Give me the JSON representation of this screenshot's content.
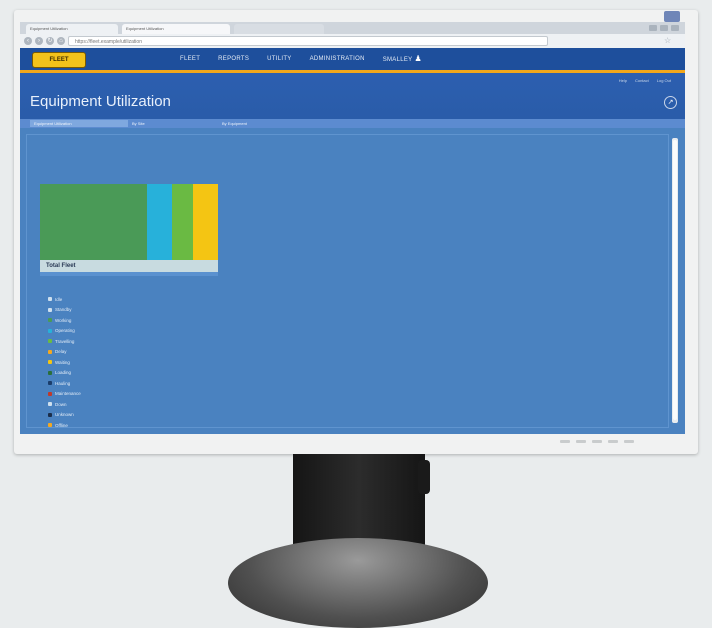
{
  "browser": {
    "tabs": [
      {
        "label": "Equipment Utilization"
      },
      {
        "label": "Equipment Utilization"
      },
      {
        "label": ""
      }
    ],
    "url": "https://fleet.example/utilization"
  },
  "app": {
    "logo_text": "FLEET",
    "menu": [
      "FLEET",
      "REPORTS",
      "UTILITY",
      "ADMINISTRATION",
      "SMALLEY"
    ],
    "utility_links": [
      "Help",
      "Contact",
      "Log Out"
    ],
    "page_title": "Equipment Utilization",
    "subtabs": [
      "Equipment Utilization",
      "By Site",
      "By Equipment"
    ]
  },
  "treemap": {
    "caption_label": "Total Fleet",
    "caption_value": "",
    "cells": [
      {
        "color": "#4a9a57",
        "share": 0.6
      },
      {
        "color": "#27b1da",
        "share": 0.14
      },
      {
        "color": "#6aba43",
        "share": 0.12
      },
      {
        "color": "#f4c513",
        "share": 0.14
      }
    ]
  },
  "legend": [
    {
      "label": "Idle",
      "color": "#cfe0ee"
    },
    {
      "label": "Standby",
      "color": "#cfe0ee"
    },
    {
      "label": "Working",
      "color": "#4a9a57"
    },
    {
      "label": "Operating",
      "color": "#27b1da"
    },
    {
      "label": "Travelling",
      "color": "#6aba43"
    },
    {
      "label": "Delay",
      "color": "#f4a820"
    },
    {
      "label": "Waiting",
      "color": "#f4c513"
    },
    {
      "label": "Loading",
      "color": "#2a6f3a"
    },
    {
      "label": "Hauling",
      "color": "#1b3d6b"
    },
    {
      "label": "Maintenance",
      "color": "#c0392b"
    },
    {
      "label": "Down",
      "color": "#cfe0ee"
    },
    {
      "label": "Unknown",
      "color": "#1b2d4a"
    },
    {
      "label": "Offline",
      "color": "#f4a820"
    }
  ]
}
